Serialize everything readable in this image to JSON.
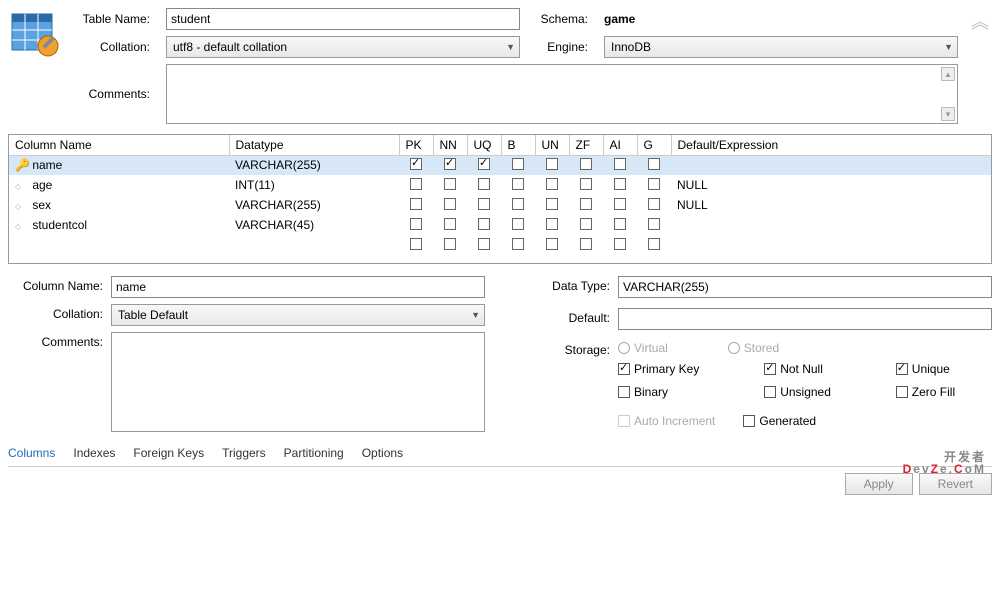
{
  "header": {
    "tableNameLabel": "Table Name:",
    "tableName": "student",
    "schemaLabel": "Schema:",
    "schema": "game",
    "collationLabel": "Collation:",
    "collation": "utf8 - default collation",
    "engineLabel": "Engine:",
    "engine": "InnoDB",
    "commentsLabel": "Comments:"
  },
  "columnsGrid": {
    "headers": [
      "Column Name",
      "Datatype",
      "PK",
      "NN",
      "UQ",
      "B",
      "UN",
      "ZF",
      "AI",
      "G",
      "Default/Expression"
    ],
    "rows": [
      {
        "icon": "key",
        "name": "name",
        "datatype": "VARCHAR(255)",
        "pk": true,
        "nn": true,
        "uq": true,
        "b": false,
        "un": false,
        "zf": false,
        "ai": false,
        "g": false,
        "def": "",
        "selected": true
      },
      {
        "icon": "diamond",
        "name": "age",
        "datatype": "INT(11)",
        "pk": false,
        "nn": false,
        "uq": false,
        "b": false,
        "un": false,
        "zf": false,
        "ai": false,
        "g": false,
        "def": "NULL"
      },
      {
        "icon": "diamond",
        "name": "sex",
        "datatype": "VARCHAR(255)",
        "pk": false,
        "nn": false,
        "uq": false,
        "b": false,
        "un": false,
        "zf": false,
        "ai": false,
        "g": false,
        "def": "NULL"
      },
      {
        "icon": "diamond",
        "name": "studentcol",
        "datatype": "VARCHAR(45)",
        "pk": false,
        "nn": false,
        "uq": false,
        "b": false,
        "un": false,
        "zf": false,
        "ai": false,
        "g": false,
        "def": ""
      },
      {
        "icon": "",
        "name": "",
        "datatype": "",
        "pk": false,
        "nn": false,
        "uq": false,
        "b": false,
        "un": false,
        "zf": false,
        "ai": false,
        "g": false,
        "def": ""
      }
    ]
  },
  "detail": {
    "colNameLabel": "Column Name:",
    "colName": "name",
    "collationLabel": "Collation:",
    "collation": "Table Default",
    "commentsLabel": "Comments:",
    "dataTypeLabel": "Data Type:",
    "dataType": "VARCHAR(255)",
    "defaultLabel": "Default:",
    "defaultVal": "",
    "storageLabel": "Storage:",
    "virtual": "Virtual",
    "stored": "Stored",
    "primaryKey": "Primary Key",
    "notNull": "Not Null",
    "unique": "Unique",
    "binary": "Binary",
    "unsigned": "Unsigned",
    "zeroFill": "Zero Fill",
    "autoInc": "Auto Increment",
    "generated": "Generated",
    "flags": {
      "primaryKey": true,
      "notNull": true,
      "unique": true,
      "binary": false,
      "unsigned": false,
      "zeroFill": false,
      "autoInc": false,
      "generated": false
    }
  },
  "tabs": [
    "Columns",
    "Indexes",
    "Foreign Keys",
    "Triggers",
    "Partitioning",
    "Options"
  ],
  "activeTab": "Columns",
  "buttons": {
    "apply": "Apply",
    "revert": "Revert"
  },
  "watermark": {
    "line1": "开发者",
    "line2": "DevZe.CoM"
  }
}
